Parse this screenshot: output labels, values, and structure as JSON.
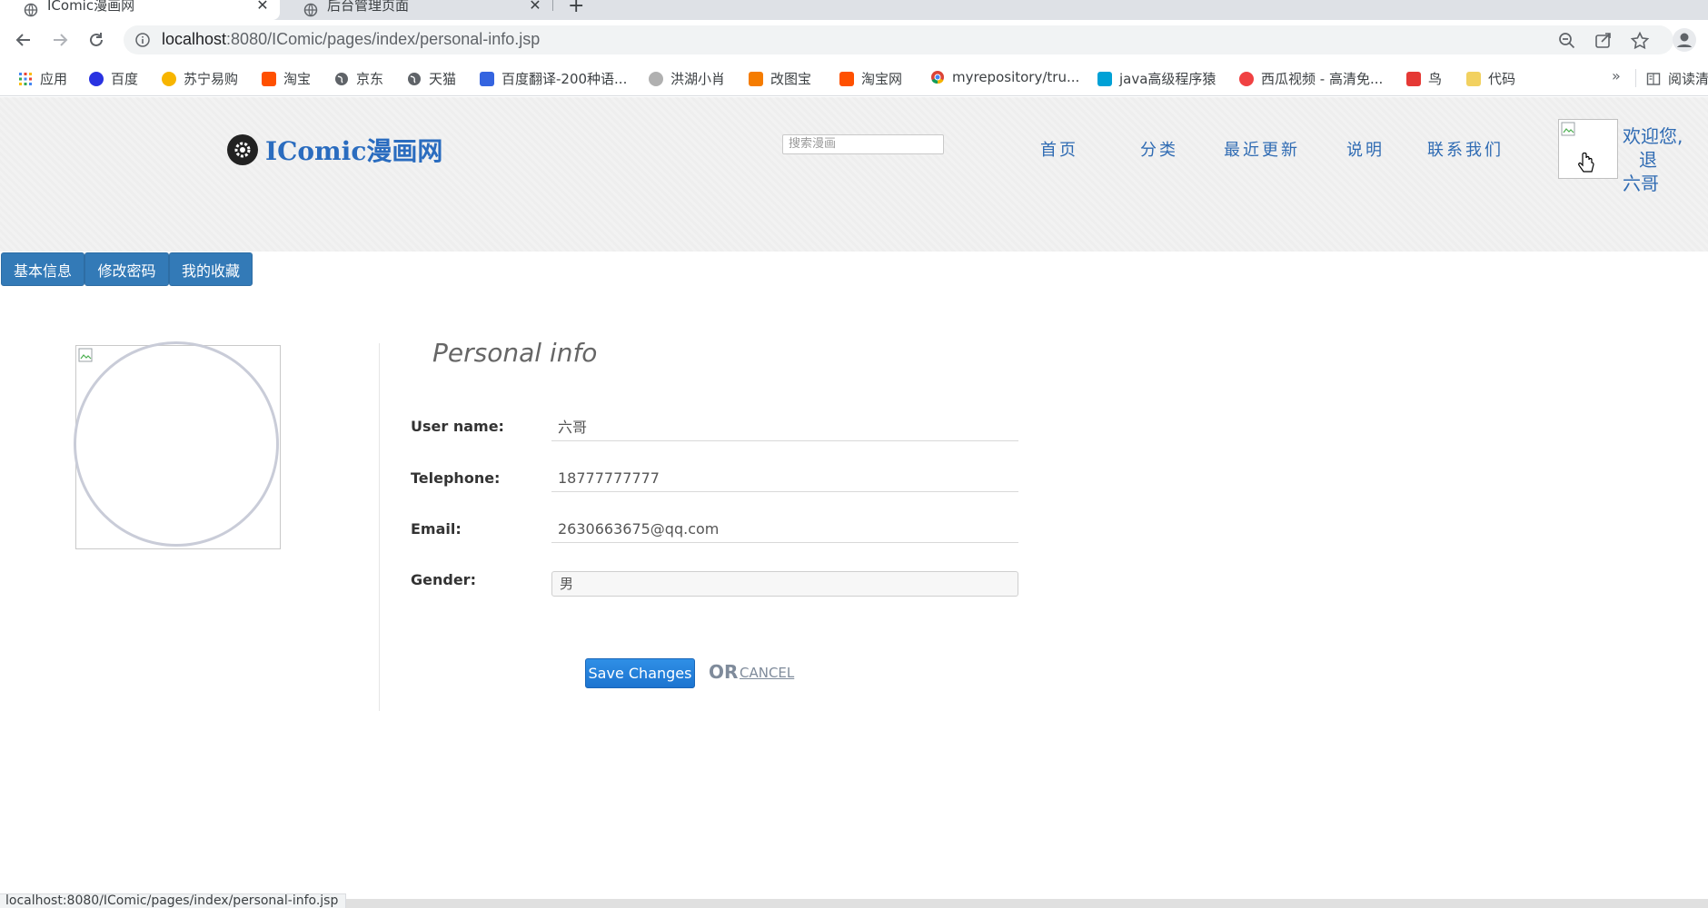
{
  "browser": {
    "tabs": [
      {
        "title": "IComic漫画网",
        "active": true
      },
      {
        "title": "后台管理页面",
        "active": false
      }
    ],
    "url": {
      "host": "localhost",
      "rest": ":8080/IComic/pages/index/personal-info.jsp"
    },
    "bookmarks": [
      {
        "label": "应用",
        "icon": "apps-grid-icon",
        "color": "#4285f4"
      },
      {
        "label": "百度",
        "icon": "baidu-paw-icon",
        "color": "#2932e1"
      },
      {
        "label": "苏宁易购",
        "icon": "suning-icon",
        "color": "#f7b500"
      },
      {
        "label": "淘宝",
        "icon": "taobao-icon",
        "color": "#ff5000"
      },
      {
        "label": "京东",
        "icon": "globe-icon",
        "color": "#5f6368"
      },
      {
        "label": "天猫",
        "icon": "globe-icon",
        "color": "#5f6368"
      },
      {
        "label": "百度翻译-200种语...",
        "icon": "translate-icon",
        "color": "#3464e0"
      },
      {
        "label": "洪湖小肖",
        "icon": "bird-icon",
        "color": "#888888"
      },
      {
        "label": "改图宝",
        "icon": "gaitubao-icon",
        "color": "#f57c00"
      },
      {
        "label": "淘宝网",
        "icon": "taobao-icon",
        "color": "#ff5000"
      },
      {
        "label": "myrepository/tru...",
        "icon": "chrome-icon",
        "color": "#db4437"
      },
      {
        "label": "java高级程序猿",
        "icon": "bilibili-icon",
        "color": "#00a1d6"
      },
      {
        "label": "西瓜视频 - 高清免...",
        "icon": "xigua-icon",
        "color": "#f04142"
      },
      {
        "label": "鸟",
        "icon": "bird-red-icon",
        "color": "#e53935"
      },
      {
        "label": "代码",
        "icon": "folder-icon",
        "color": "#f2d160"
      }
    ],
    "reading_list": "阅读清单",
    "status_url": "localhost:8080/IComic/pages/index/personal-info.jsp"
  },
  "site": {
    "logo": "IComic漫画网",
    "search_placeholder": "搜索漫画",
    "nav": [
      "首页",
      "分类",
      "最近更新",
      "说明",
      "联系我们"
    ],
    "welcome_line1": "欢迎您,",
    "welcome_line2": "六哥",
    "welcome_tail": "退"
  },
  "tabs": [
    "基本信息",
    "修改密码",
    "我的收藏"
  ],
  "form": {
    "title": "Personal info",
    "fields": [
      {
        "label": "User name:",
        "value": "六哥"
      },
      {
        "label": "Telephone:",
        "value": "18777777777"
      },
      {
        "label": "Email:",
        "value": "2630663675@qq.com"
      }
    ],
    "gender_label": "Gender:",
    "gender_value": "男",
    "save_label": "Save Changes",
    "or_label": "OR",
    "cancel_label": "CANCEL"
  },
  "colors": {
    "accent": "#337ab7",
    "link": "#2f6bb3",
    "save": "#1c74d0"
  }
}
